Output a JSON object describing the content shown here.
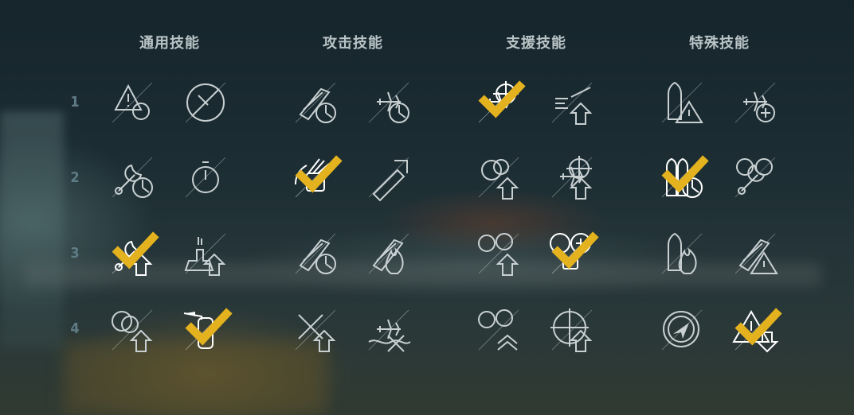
{
  "columns": [
    {
      "title": "通用技能"
    },
    {
      "title": "攻击技能"
    },
    {
      "title": "支援技能"
    },
    {
      "title": "特殊技能"
    }
  ],
  "rows": [
    {
      "label": "1"
    },
    {
      "label": "2"
    },
    {
      "label": "3"
    },
    {
      "label": "4"
    }
  ],
  "skills": [
    {
      "icon": "warning-target-icon",
      "selected": false
    },
    {
      "icon": "no-fuse-icon",
      "selected": false
    },
    {
      "icon": "shell-reload-icon",
      "selected": false
    },
    {
      "icon": "plane-timer-icon",
      "selected": false
    },
    {
      "icon": "fighter-target-icon",
      "selected": true
    },
    {
      "icon": "plane-speed-icon",
      "selected": false
    },
    {
      "icon": "hull-warning-icon",
      "selected": false
    },
    {
      "icon": "plane-heal-icon",
      "selected": false
    },
    {
      "icon": "wrench-timer-icon",
      "selected": false
    },
    {
      "icon": "stopwatch-icon",
      "selected": false
    },
    {
      "icon": "turret-traverse-icon",
      "selected": true
    },
    {
      "icon": "torpedo-range-icon",
      "selected": false
    },
    {
      "icon": "smoke-shell-icon",
      "selected": false
    },
    {
      "icon": "plane-upgrade-icon",
      "selected": false
    },
    {
      "icon": "torpedo-timer-icon",
      "selected": true
    },
    {
      "icon": "repair-steer-icon",
      "selected": false
    },
    {
      "icon": "wrench-up-icon",
      "selected": true
    },
    {
      "icon": "battleship-up-icon",
      "selected": false
    },
    {
      "icon": "shell-timer-icon",
      "selected": false
    },
    {
      "icon": "fire-shell-icon",
      "selected": false
    },
    {
      "icon": "consumable-up-icon",
      "selected": false
    },
    {
      "icon": "consumable-heal-icon",
      "selected": true
    },
    {
      "icon": "hull-fire-icon",
      "selected": false
    },
    {
      "icon": "shells-warning-icon",
      "selected": false
    },
    {
      "icon": "smoke-up-icon",
      "selected": false
    },
    {
      "icon": "extinguisher-icon",
      "selected": true
    },
    {
      "icon": "cross-up-icon",
      "selected": false
    },
    {
      "icon": "fighters-wave-icon",
      "selected": false
    },
    {
      "icon": "consumable-double-up-icon",
      "selected": false
    },
    {
      "icon": "aa-target-up-icon",
      "selected": false
    },
    {
      "icon": "radar-compass-icon",
      "selected": false
    },
    {
      "icon": "warning-down-icon",
      "selected": true
    }
  ],
  "colors": {
    "title": "#b9c4c7",
    "row_number": "#5f7b86",
    "icon_normal": "#c8d0d2",
    "icon_selected": "#ffffff",
    "checkmark": "#e3b21e"
  }
}
